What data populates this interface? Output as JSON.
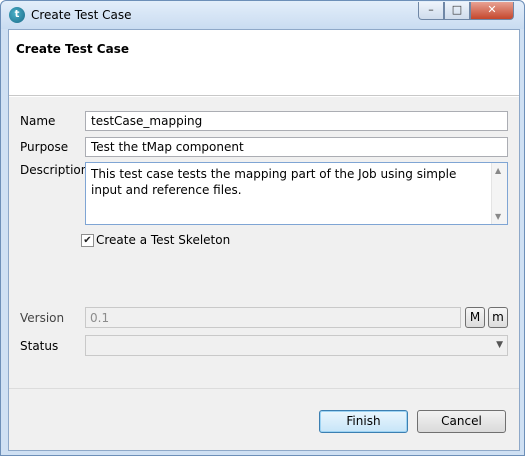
{
  "window": {
    "title": "Create Test Case",
    "app_icon_glyph": "t",
    "controls": {
      "minimize": "–",
      "maximize": "□",
      "close": "✕"
    }
  },
  "header": {
    "title": "Create Test Case"
  },
  "form": {
    "name_label": "Name",
    "name_value": "testCase_mapping",
    "purpose_label": "Purpose",
    "purpose_value": "Test the tMap component",
    "description_label": "Description",
    "description_value": "This test case tests the mapping part of the Job using simple input and reference files.",
    "skeleton_checked": true,
    "skeleton_label": "Create a Test Skeleton",
    "version_label": "Version",
    "version_value": "0.1",
    "major_button": "M",
    "minor_button": "m",
    "status_label": "Status",
    "status_value": ""
  },
  "buttons": {
    "finish": "Finish",
    "cancel": "Cancel"
  },
  "icons": {
    "app": "talend-icon",
    "check": "✔",
    "up_arrow": "▲",
    "down_arrow": "▼"
  }
}
